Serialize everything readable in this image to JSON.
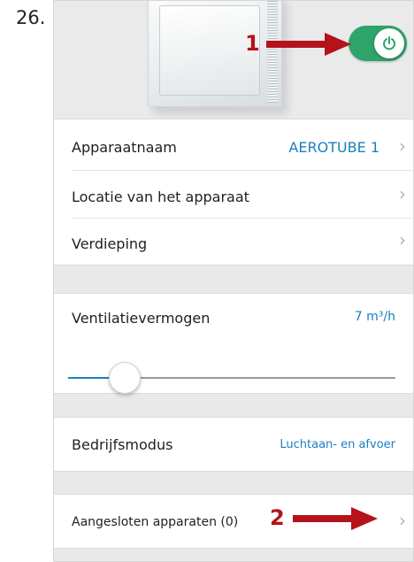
{
  "step_number": "26.",
  "device": {
    "power_toggle_state": "on",
    "power_toggle_color": "#2ea36a"
  },
  "callouts": {
    "one": "1",
    "two": "2",
    "color": "#b5121b"
  },
  "rows": {
    "device_name": {
      "label": "Apparaatnaam",
      "value": "AEROTUBE 1"
    },
    "location": {
      "label": "Locatie van het apparaat"
    },
    "floor": {
      "label": "Verdieping"
    },
    "ventilation": {
      "label": "Ventilatievermogen",
      "value": "7 m³/h",
      "level": 0.2
    },
    "mode": {
      "label": "Bedrijfsmodus",
      "value": "Luchtaan- en afvoer"
    },
    "connected": {
      "label": "Aangesloten apparaten (0)"
    }
  },
  "chevron": "›",
  "accent_color": "#1a7fc1"
}
